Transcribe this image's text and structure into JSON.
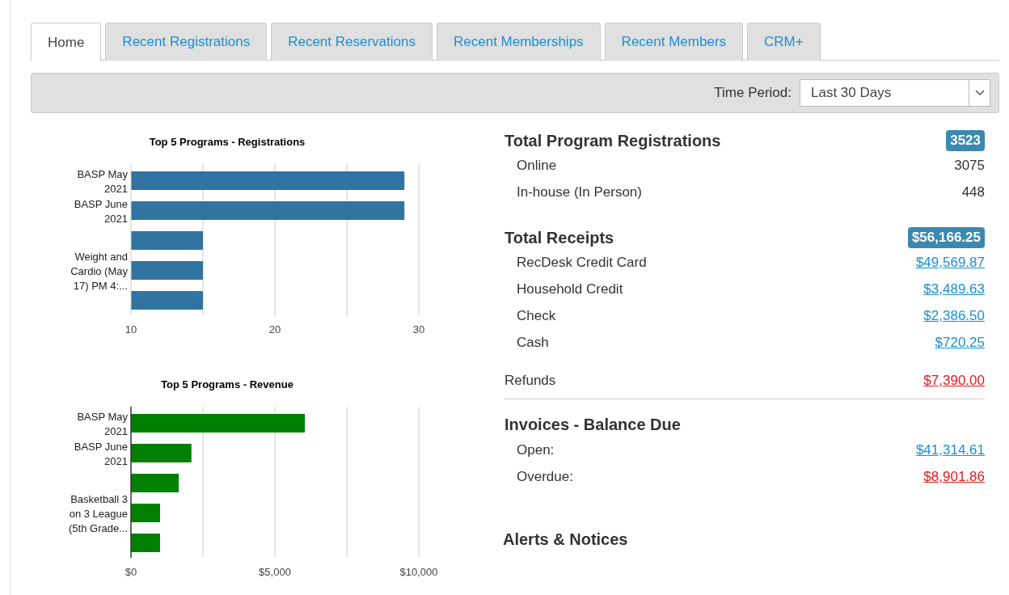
{
  "tabs": [
    {
      "label": "Home",
      "selected": true
    },
    {
      "label": "Recent Registrations",
      "selected": false
    },
    {
      "label": "Recent Reservations",
      "selected": false
    },
    {
      "label": "Recent Memberships",
      "selected": false
    },
    {
      "label": "Recent Members",
      "selected": false
    },
    {
      "label": "CRM+",
      "selected": false
    }
  ],
  "toolbar": {
    "label": "Time Period:",
    "time_period": "Last 30 Days"
  },
  "charts": [
    {
      "chart_data": {
        "type": "bar",
        "orientation": "horizontal",
        "title": "Top 5 Programs - Registrations",
        "categories": [
          "BASP May 2021",
          "BASP June 2021",
          null,
          "Weight and Cardio (May 17) PM 4:...",
          null
        ],
        "series": [
          {
            "color": "#3274a1",
            "values": [
              29,
              29,
              15,
              15,
              15
            ]
          }
        ],
        "xlim": [
          10,
          30
        ],
        "xticks": [
          10,
          20,
          30
        ]
      }
    },
    {
      "chart_data": {
        "type": "bar",
        "orientation": "horizontal",
        "title": "Top 5 Programs - Revenue",
        "categories": [
          "BASP May 2021",
          "BASP June 2021",
          null,
          "Basketball 3 on 3 League (5th Grade...",
          null
        ],
        "series": [
          {
            "color": "#008000",
            "values": [
              6040,
              2100,
              1660,
              1010,
              1010
            ]
          }
        ],
        "xlim": [
          0,
          10000
        ],
        "xticks": [
          {
            "value": 0,
            "label": "$0"
          },
          {
            "value": 5000,
            "label": "$5,000"
          },
          {
            "value": 10000,
            "label": "$10,000"
          }
        ]
      }
    }
  ],
  "sections": [
    {
      "title": "Total Program Registrations",
      "total": "3523",
      "rows": [
        {
          "label": "Online",
          "value": "3075",
          "kind": "plain"
        },
        {
          "label": "In-house (In Person)",
          "value": "448",
          "kind": "plain"
        }
      ]
    },
    {
      "title": "Total Receipts",
      "total": "$56,166.25",
      "rows": [
        {
          "label": "RecDesk Credit Card",
          "value": "$49,569.87",
          "kind": "link"
        },
        {
          "label": "Household Credit",
          "value": "$3,489.63",
          "kind": "link"
        },
        {
          "label": "Check",
          "value": "$2,386.50",
          "kind": "link"
        },
        {
          "label": "Cash",
          "value": "$720.25",
          "kind": "link"
        }
      ]
    }
  ],
  "refunds": {
    "label": "Refunds",
    "value": "$7,390.00",
    "kind": "alert"
  },
  "invoices": {
    "title": "Invoices - Balance Due",
    "rows": [
      {
        "label": "Open:",
        "value": "$41,314.61",
        "kind": "link"
      },
      {
        "label": "Overdue:",
        "value": "$8,901.86",
        "kind": "alert"
      }
    ]
  },
  "alerts": {
    "title": "Alerts & Notices"
  }
}
